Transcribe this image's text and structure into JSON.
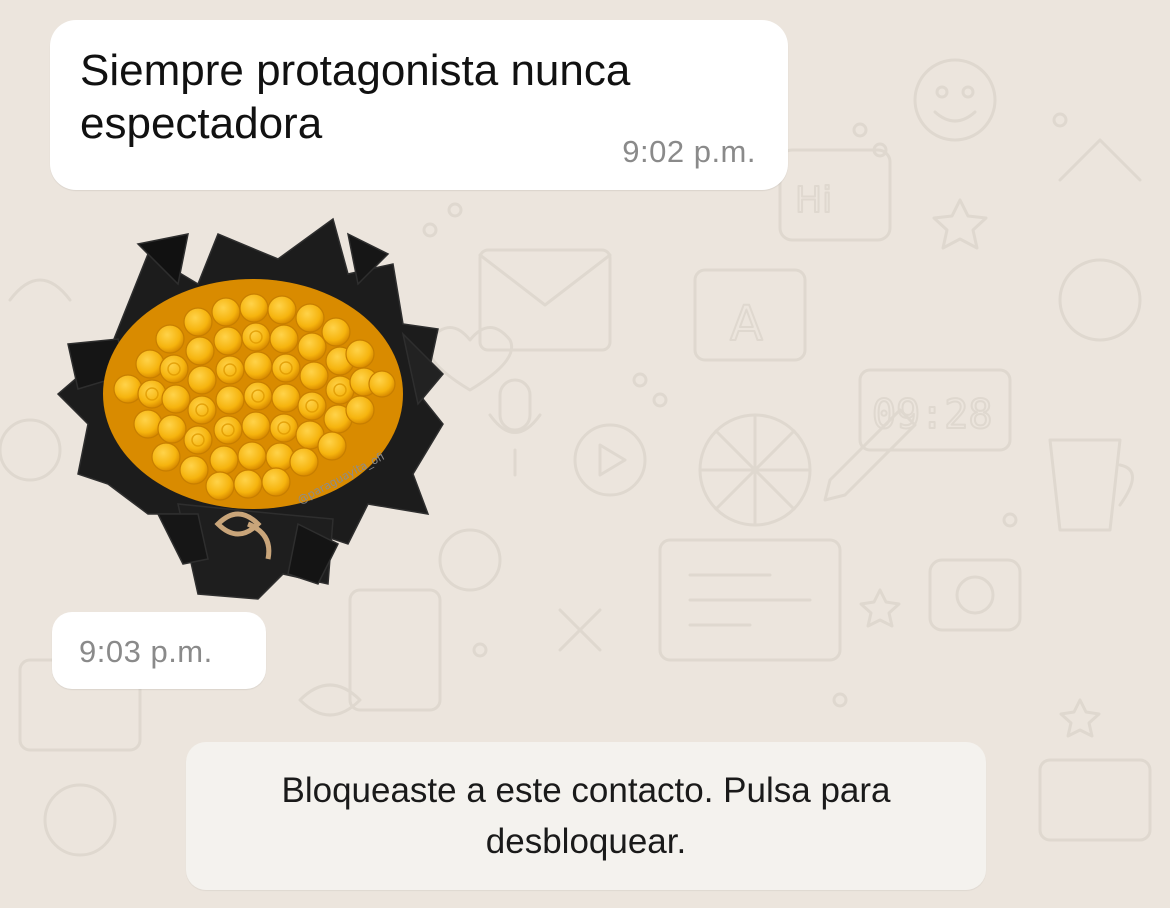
{
  "chat": {
    "messages": [
      {
        "type": "text",
        "text": "Siempre protagonista nunca espectadora",
        "time": "9:02 p.m."
      },
      {
        "type": "sticker",
        "sticker_icon": "yellow-rose-bouquet-icon",
        "watermark": "@paraguayita_ofi",
        "time": "9:03 p.m."
      }
    ],
    "blocked_notice": "Bloqueaste a este contacto. Pulsa para desbloquear."
  },
  "colors": {
    "wallpaper": "#ECE5DD",
    "bubble": "#FFFFFF",
    "timestamp": "#8A8A8A",
    "notice_bg": "#F4F2EE",
    "rose": "#F6B40E",
    "wrapping": "#1C1C1C"
  }
}
